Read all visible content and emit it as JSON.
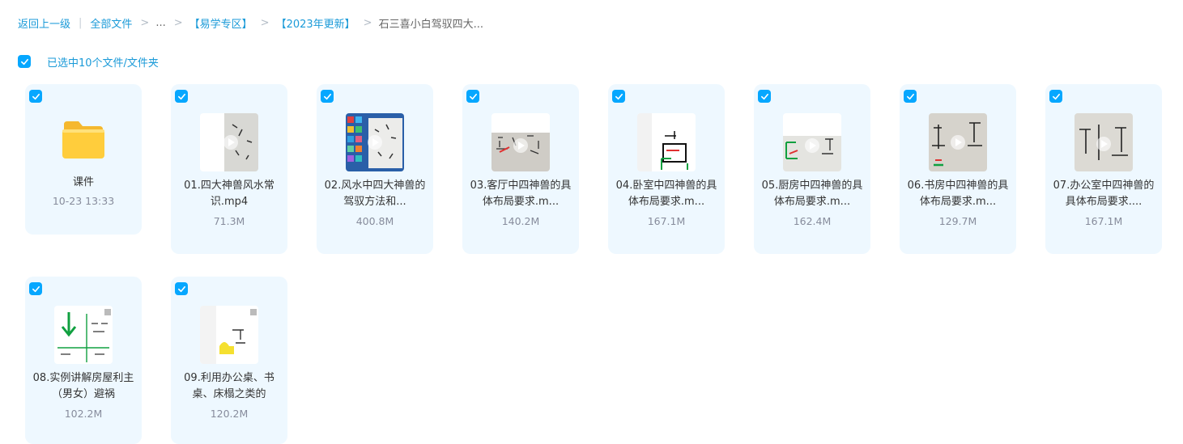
{
  "breadcrumb": {
    "back": "返回上一级",
    "root": "全部文件",
    "ellipsis": "...",
    "level1": "【易学专区】",
    "level2": "【2023年更新】",
    "current": "石三喜小白驾驭四大..."
  },
  "selection": {
    "text": "已选中10个文件/文件夹",
    "checked": true
  },
  "colors": {
    "accent": "#06a7ff",
    "link": "#1a9ad8",
    "card_bg": "#eef8ff",
    "meta": "#878c9c"
  },
  "items": [
    {
      "type": "folder",
      "name": "课件",
      "meta": "10-23 13:33",
      "checked": true
    },
    {
      "type": "video",
      "name": "01.四大神兽风水常识.mp4",
      "meta": "71.3M",
      "checked": true
    },
    {
      "type": "video",
      "name": "02.风水中四大神兽的驾驭方法和...",
      "meta": "400.8M",
      "checked": true
    },
    {
      "type": "video",
      "name": "03.客厅中四神兽的具体布局要求.m...",
      "meta": "140.2M",
      "checked": true
    },
    {
      "type": "video",
      "name": "04.卧室中四神兽的具体布局要求.m...",
      "meta": "167.1M",
      "checked": true
    },
    {
      "type": "video",
      "name": "05.厨房中四神兽的具体布局要求.m...",
      "meta": "162.4M",
      "checked": true
    },
    {
      "type": "video",
      "name": "06.书房中四神兽的具体布局要求.m...",
      "meta": "129.7M",
      "checked": true
    },
    {
      "type": "video",
      "name": "07.办公室中四神兽的具体布局要求....",
      "meta": "167.1M",
      "checked": true
    },
    {
      "type": "video",
      "name": "08.实例讲解房屋利主（男女）避祸",
      "meta": "102.2M",
      "checked": true
    },
    {
      "type": "video",
      "name": "09.利用办公桌、书桌、床榻之类的",
      "meta": "120.2M",
      "checked": true
    }
  ]
}
